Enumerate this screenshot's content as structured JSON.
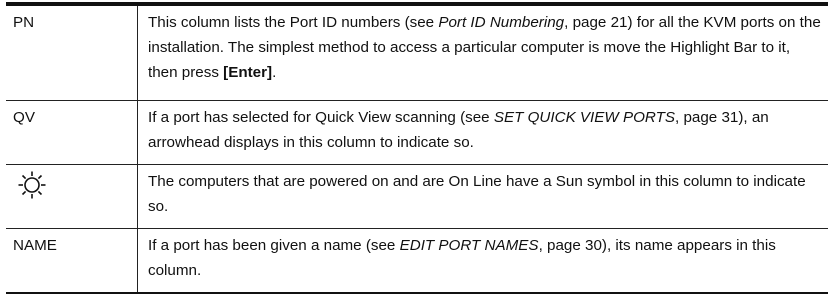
{
  "rows": [
    {
      "term": "PN",
      "desc": {
        "p1": "This column lists the Port ID numbers (see ",
        "i1": "Port ID Numbering",
        "p2": ", page 21) for all the KVM ports on the installation. The simplest method to access a particular computer is move the Highlight Bar to it, then press ",
        "b1": "[Enter]",
        "p3": "."
      }
    },
    {
      "term": "QV",
      "desc": {
        "p1": "If a port has selected for Quick View scanning (see ",
        "i1": "SET QUICK VIEW PORTS",
        "p2": ", page 31), an arrowhead displays in this column to indicate so."
      }
    },
    {
      "term_icon": "sun-icon",
      "desc": {
        "p1": "The computers that are powered on and are On Line have a Sun symbol in this column to indicate so."
      }
    },
    {
      "term": "NAME",
      "desc": {
        "p1": "If a port has been given a name (see ",
        "i1": "EDIT PORT NAMES",
        "p2": ", page 30), its name appears in this column."
      }
    }
  ]
}
